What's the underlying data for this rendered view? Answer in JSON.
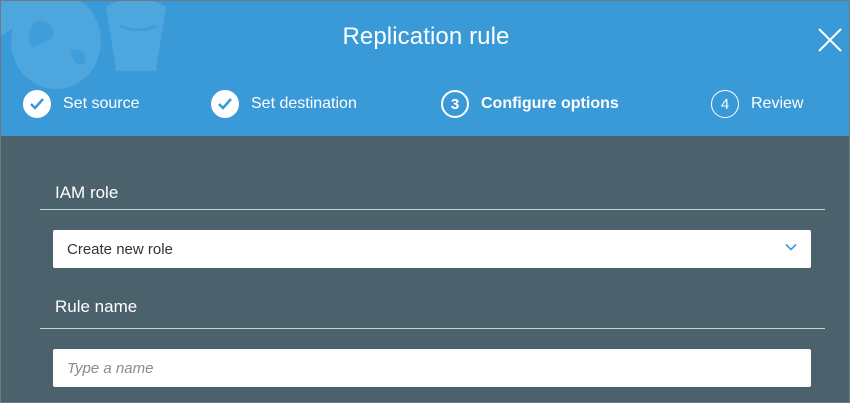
{
  "dialog": {
    "title": "Replication rule",
    "close_icon": "close-icon"
  },
  "steps": [
    {
      "label": "Set source",
      "state": "complete",
      "icon": "check-circle-icon"
    },
    {
      "label": "Set destination",
      "state": "complete",
      "icon": "check-circle-icon"
    },
    {
      "number": "3",
      "label": "Configure options",
      "state": "active"
    },
    {
      "number": "4",
      "label": "Review",
      "state": "pending"
    }
  ],
  "iam_role": {
    "label": "IAM role",
    "selected": "Create new role",
    "icon": "chevron-down-icon"
  },
  "rule_name": {
    "label": "Rule name",
    "value": "",
    "placeholder": "Type a name"
  },
  "colors": {
    "header_bg": "#3a9ad8",
    "body_bg": "#4b626d",
    "accent": "#3a9ad8"
  }
}
